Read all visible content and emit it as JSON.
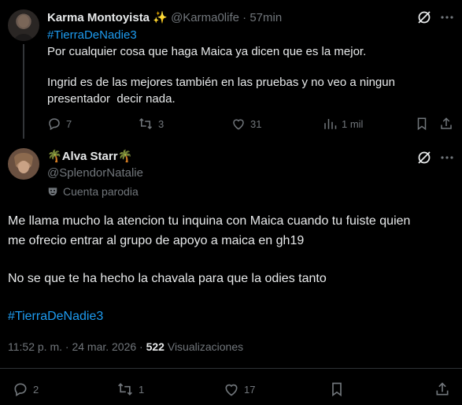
{
  "parent_tweet": {
    "display_name": "Karma Montoyista",
    "name_emoji": "✨",
    "handle": "@Karma0life",
    "time": "· 57min",
    "hashtag": "#TierraDeNadie3",
    "text_line1": "Por cualquier cosa que haga Maica ya dicen que es la mejor.",
    "text_line2": "Ingrid es de las mejores también en las pruebas y no veo a ningun",
    "text_line3": "presentador  decir nada.",
    "stats": {
      "replies": "7",
      "retweets": "3",
      "likes": "31",
      "views": "1 mil"
    }
  },
  "main_tweet": {
    "name_prefix_emoji": "🌴",
    "display_name": "Alva Starr",
    "name_suffix_emoji": "🌴",
    "handle": "@SplendorNatalie",
    "parody_label": "Cuenta parodia",
    "text_line1": "Me llama mucho la atencion tu inquina con Maica cuando tu fuiste quien",
    "text_line2": "me ofrecio entrar al grupo de apoyo a maica en gh19",
    "text_line3": "No se que te ha hecho la chavala para que la odies tanto",
    "hashtag": "#TierraDeNadie3",
    "timestamp": "11:52 p. m. · 24 mar. 2026 ·",
    "views_count": "522",
    "views_label": "Visualizaciones",
    "stats": {
      "replies": "2",
      "retweets": "1",
      "likes": "17"
    }
  },
  "colors": {
    "background": "#000000",
    "text": "#e7e9ea",
    "muted": "#71767b",
    "link": "#1d9bf0",
    "divider": "#2f3336"
  }
}
